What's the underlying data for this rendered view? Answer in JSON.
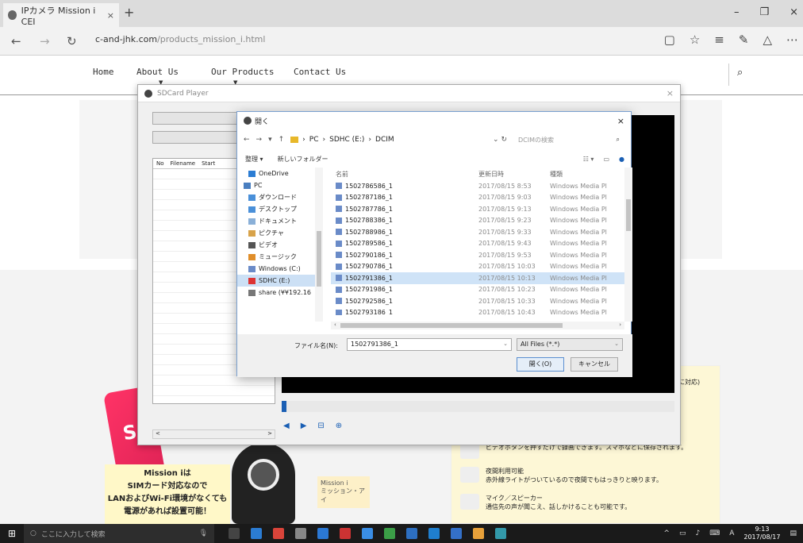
{
  "browser": {
    "tab_title": "IPカメラ Mission i CEI",
    "tab_close": "×",
    "new_tab": "+",
    "address_domain": "c-and-jhk.com",
    "address_path": "/products_mission_i.html",
    "window_buttons": [
      "–",
      "❐",
      "×"
    ]
  },
  "site": {
    "nav": [
      "Home",
      "About Us",
      "Our Products",
      "Contact Us"
    ],
    "search_icon": "search-icon",
    "promo_lines": [
      "Mission iは",
      "SIMカード対応なので",
      "LANおよびWi-Fi環境がなくても",
      "電源があれば設置可能！"
    ],
    "mission_label": "Mission i",
    "mission_sub": "ミッション・アイ",
    "features": [
      {
        "title": "",
        "desc": "ビデオボタンを押すだけで録画できます。スマホなどに保存されます。"
      },
      {
        "title": "夜間利用可能",
        "desc": "赤外線ライトがついているので夜間でもはっきりと映ります。"
      },
      {
        "title": "マイク／スピーカー",
        "desc": "通信先の声が聞こえ、話しかけることも可能です。"
      }
    ],
    "side_text": "に対応)",
    "badge_letter": "S"
  },
  "player": {
    "title": "SDCard Player",
    "list_headers": [
      "No",
      "Filename",
      "Start"
    ]
  },
  "dialog": {
    "title": "開く",
    "breadcrumb": [
      "PC",
      "SDHC (E:)",
      "DCIM"
    ],
    "search_placeholder": "DCIMの検索",
    "toolbar": {
      "organize": "整理 ▾",
      "new_folder": "新しいフォルダー"
    },
    "tree": [
      {
        "label": "OneDrive",
        "icon": "cloud-icon",
        "selected": false
      },
      {
        "label": "PC",
        "icon": "pc-icon",
        "selected": false
      },
      {
        "label": "ダウンロード",
        "icon": "download-icon",
        "selected": false
      },
      {
        "label": "デスクトップ",
        "icon": "desktop-icon",
        "selected": false
      },
      {
        "label": "ドキュメント",
        "icon": "document-icon",
        "selected": false
      },
      {
        "label": "ピクチャ",
        "icon": "picture-icon",
        "selected": false
      },
      {
        "label": "ビデオ",
        "icon": "video-icon",
        "selected": false
      },
      {
        "label": "ミュージック",
        "icon": "music-icon",
        "selected": false
      },
      {
        "label": "Windows (C:)",
        "icon": "drive-icon",
        "selected": false
      },
      {
        "label": "SDHC (E:)",
        "icon": "sd-icon",
        "selected": true
      },
      {
        "label": "share (¥¥192.16",
        "icon": "network-icon",
        "selected": false
      }
    ],
    "columns": [
      "名前",
      "更新日時",
      "種類"
    ],
    "files": [
      {
        "name": "1502786586_1",
        "date": "2017/08/15 8:53",
        "type": "Windows Media Pl"
      },
      {
        "name": "1502787186_1",
        "date": "2017/08/15 9:03",
        "type": "Windows Media Pl"
      },
      {
        "name": "1502787786_1",
        "date": "2017/08/15 9:13",
        "type": "Windows Media Pl"
      },
      {
        "name": "1502788386_1",
        "date": "2017/08/15 9:23",
        "type": "Windows Media Pl"
      },
      {
        "name": "1502788986_1",
        "date": "2017/08/15 9:33",
        "type": "Windows Media Pl"
      },
      {
        "name": "1502789586_1",
        "date": "2017/08/15 9:43",
        "type": "Windows Media Pl"
      },
      {
        "name": "1502790186_1",
        "date": "2017/08/15 9:53",
        "type": "Windows Media Pl"
      },
      {
        "name": "1502790786_1",
        "date": "2017/08/15 10:03",
        "type": "Windows Media Pl"
      },
      {
        "name": "1502791386_1",
        "date": "2017/08/15 10:13",
        "type": "Windows Media Pl"
      },
      {
        "name": "1502791986_1",
        "date": "2017/08/15 10:23",
        "type": "Windows Media Pl"
      },
      {
        "name": "1502792586_1",
        "date": "2017/08/15 10:33",
        "type": "Windows Media Pl"
      },
      {
        "name": "1502793186_1",
        "date": "2017/08/15 10:43",
        "type": "Windows Media Pl"
      }
    ],
    "selected_file": "1502791386_1",
    "filename_label": "ファイル名(N):",
    "filename_value": "1502791386_1",
    "filetype_value": "All Files (*.*)",
    "open_button": "開く(O)",
    "cancel_button": "キャンセル"
  },
  "taskbar": {
    "search_placeholder": "ここに入力して検索",
    "ime": "A",
    "time": "9:13",
    "date": "2017/08/17"
  },
  "colors": {
    "accent": "#1a5fb4",
    "selection": "#cfe3f7",
    "taskbar": "#1a1a1a"
  }
}
